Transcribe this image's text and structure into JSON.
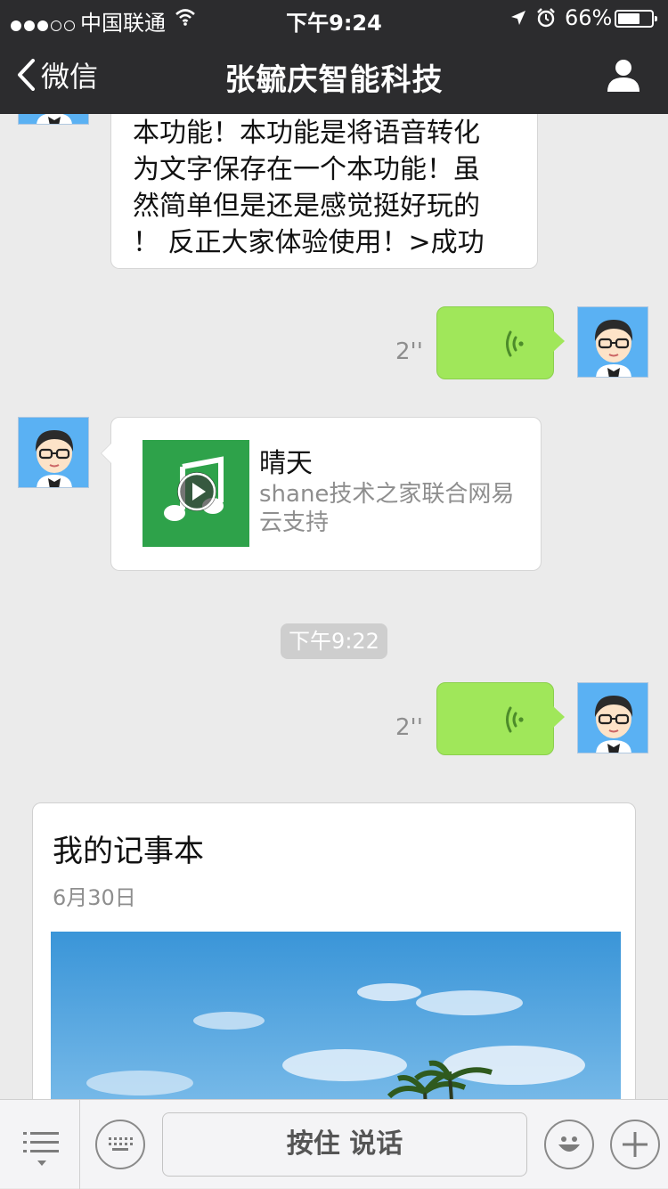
{
  "status_bar": {
    "carrier": "中国联通",
    "time": "下午9:24",
    "battery": "66%",
    "battery_level": 0.66,
    "signal_bars": 3,
    "signal_total": 5
  },
  "nav": {
    "back_label": "微信",
    "title": "张毓庆智能科技"
  },
  "messages": {
    "text_1": {
      "lines": [
        "本功能！本功能是将语音转化",
        "为文字保存在一个本功能！虽",
        "然简单但是还是感觉挺好玩的",
        "！ 反正大家体验使用！>成功"
      ]
    },
    "voice_1": {
      "duration": "2''"
    },
    "music": {
      "title": "晴天",
      "description": "shane技术之家联合网易云支持"
    },
    "timestamp": "下午9:22",
    "voice_2": {
      "duration": "2''"
    },
    "card": {
      "title": "我的记事本",
      "date": "6月30日"
    }
  },
  "input_bar": {
    "hold_to_talk": "按住 说话"
  },
  "colors": {
    "nav_bg": "#2c2c2e",
    "chat_bg": "#ebebeb",
    "sent_bubble": "#a0e75a",
    "music_cover": "#2ea24a",
    "avatar_bg": "#5ab1f3"
  }
}
